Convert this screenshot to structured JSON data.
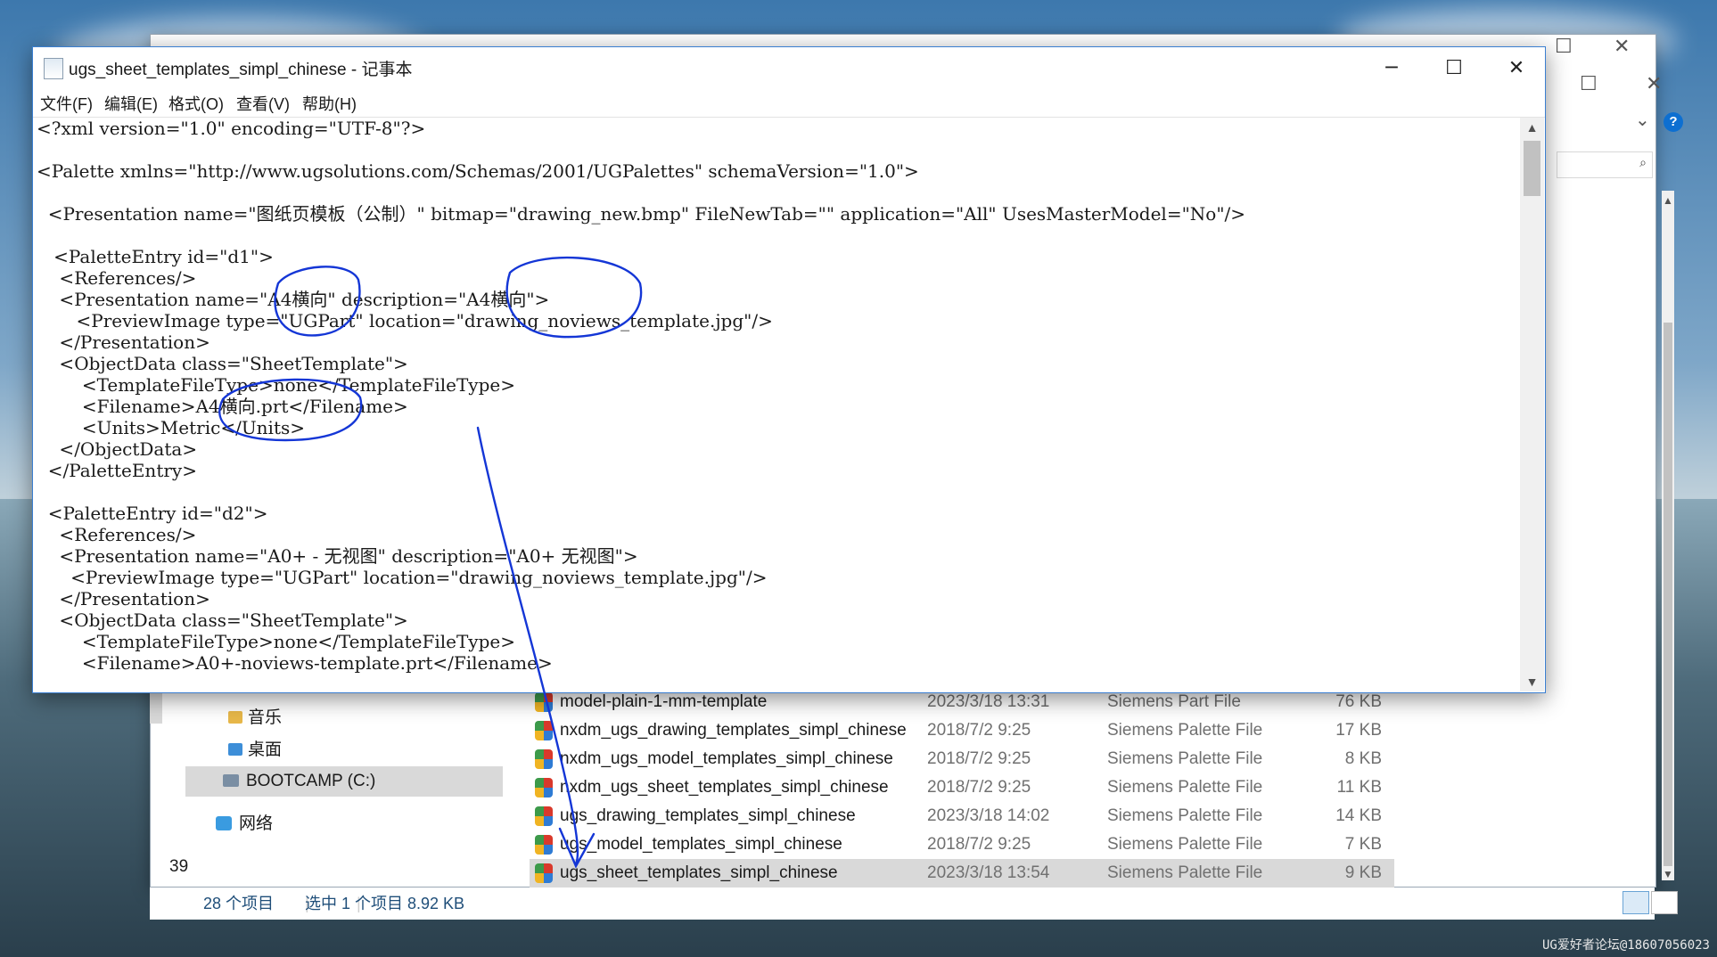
{
  "notepad": {
    "title": "ugs_sheet_templates_simpl_chinese - 记事本",
    "menu": [
      "文件(F)",
      "编辑(E)",
      "格式(O)",
      "查看(V)",
      "帮助(H)"
    ],
    "code": "<?xml version=\"1.0\" encoding=\"UTF-8\"?>\n\n<Palette xmlns=\"http://www.ugsolutions.com/Schemas/2001/UGPalettes\" schemaVersion=\"1.0\">\n\n  <Presentation name=\"图纸页模板（公制）\" bitmap=\"drawing_new.bmp\" FileNewTab=\"\" application=\"All\" UsesMasterModel=\"No\"/>\n\n   <PaletteEntry id=\"d1\">\n    <References/>\n    <Presentation name=\"A4横向\" description=\"A4横向\">\n       <PreviewImage type=\"UGPart\" location=\"drawing_noviews_template.jpg\"/>\n    </Presentation>\n    <ObjectData class=\"SheetTemplate\">\n        <TemplateFileType>none</TemplateFileType>\n        <Filename>A4横向.prt</Filename>\n        <Units>Metric</Units>\n    </ObjectData>\n  </PaletteEntry>\n\n  <PaletteEntry id=\"d2\">\n    <References/>\n    <Presentation name=\"A0+ - 无视图\" description=\"A0+ 无视图\">\n      <PreviewImage type=\"UGPart\" location=\"drawing_noviews_template.jpg\"/>\n    </Presentation>\n    <ObjectData class=\"SheetTemplate\">\n        <TemplateFileType>none</TemplateFileType>\n        <Filename>A0+-noviews-template.prt</Filename>",
    "controls": {
      "minimize": "─",
      "maximize": "☐",
      "close": "✕"
    }
  },
  "explorer": {
    "nav": [
      {
        "label": "音乐",
        "icon": "music-folder-icon"
      },
      {
        "label": "桌面",
        "icon": "desktop-folder-icon"
      },
      {
        "label": "BOOTCAMP (C:)",
        "icon": "drive-icon",
        "selected": true
      },
      {
        "label": "网络",
        "icon": "network-icon"
      }
    ],
    "files": [
      {
        "name": "model-plain-1-mm-template",
        "date": "2023/3/18 13:31",
        "type": "Siemens Part File",
        "size": "76 KB"
      },
      {
        "name": "nxdm_ugs_drawing_templates_simpl_chinese",
        "date": "2018/7/2 9:25",
        "type": "Siemens Palette File",
        "size": "17 KB"
      },
      {
        "name": "nxdm_ugs_model_templates_simpl_chinese",
        "date": "2018/7/2 9:25",
        "type": "Siemens Palette File",
        "size": "8 KB"
      },
      {
        "name": "nxdm_ugs_sheet_templates_simpl_chinese",
        "date": "2018/7/2 9:25",
        "type": "Siemens Palette File",
        "size": "11 KB"
      },
      {
        "name": "ugs_drawing_templates_simpl_chinese",
        "date": "2023/3/18 14:02",
        "type": "Siemens Palette File",
        "size": "14 KB"
      },
      {
        "name": "ugs_model_templates_simpl_chinese",
        "date": "2018/7/2 9:25",
        "type": "Siemens Palette File",
        "size": "7 KB"
      },
      {
        "name": "ugs_sheet_templates_simpl_chinese",
        "date": "2023/3/18 13:54",
        "type": "Siemens Palette File",
        "size": "9 KB",
        "selected": true
      }
    ],
    "status": {
      "count": "28 个项目",
      "selection": "选中 1 个项目  8.92 KB"
    },
    "left_edge_text": "39",
    "controls": {
      "maximize": "☐",
      "close": "✕",
      "chevron": "⌄",
      "help": "?",
      "search_icon": "🔍",
      "scroll_up": "▲",
      "scroll_down": "▼"
    }
  },
  "watermark": "UG爱好者论坛@18607056023",
  "colors": {
    "accent_blue": "#3b7fd1",
    "ink_blue": "#1436d6",
    "selection": "#cce8ff"
  }
}
